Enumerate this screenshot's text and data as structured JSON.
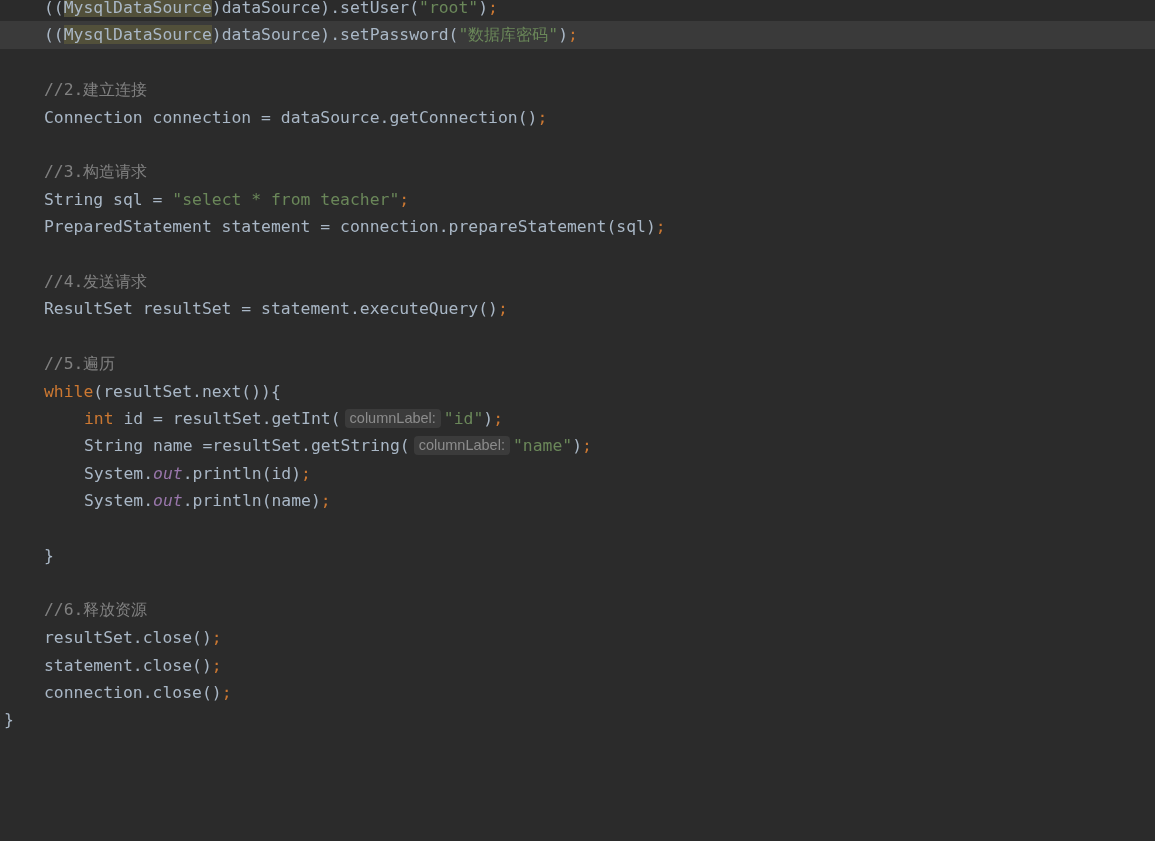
{
  "editor": {
    "items": [
      {
        "kind": "block",
        "children": [
          {
            "kind": "line",
            "current": false,
            "segments": [
              {
                "kind": "code",
                "tokens": [
                  {
                    "kind": "plain",
                    "text": "(("
                  },
                  {
                    "kind": "usage",
                    "text": "MysqlDataSource"
                  },
                  {
                    "kind": "plain",
                    "text": ")dataSource).setUser("
                  },
                  {
                    "kind": "string",
                    "text": "\"root\""
                  },
                  {
                    "kind": "plain",
                    "text": ")"
                  },
                  {
                    "kind": "punct",
                    "text": ";"
                  }
                ]
              }
            ]
          },
          {
            "kind": "line",
            "current": true,
            "segments": [
              {
                "kind": "code",
                "tokens": [
                  {
                    "kind": "plain",
                    "text": "(("
                  },
                  {
                    "kind": "usage",
                    "text": "MysqlDataSource"
                  },
                  {
                    "kind": "plain",
                    "text": ")dataSource).setPassword("
                  },
                  {
                    "kind": "string",
                    "text": "\"数据库密码\""
                  },
                  {
                    "kind": "plain",
                    "text": ")"
                  },
                  {
                    "kind": "punct",
                    "text": ";"
                  }
                ]
              }
            ]
          },
          {
            "kind": "blank"
          },
          {
            "kind": "line",
            "current": false,
            "segments": [
              {
                "kind": "code",
                "tokens": [
                  {
                    "kind": "comment",
                    "text": "//2.建立连接"
                  }
                ]
              }
            ]
          },
          {
            "kind": "line",
            "current": false,
            "segments": [
              {
                "kind": "code",
                "tokens": [
                  {
                    "kind": "plain",
                    "text": "Connection connection = dataSource.getConnection()"
                  },
                  {
                    "kind": "punct",
                    "text": ";"
                  }
                ]
              }
            ]
          },
          {
            "kind": "blank"
          },
          {
            "kind": "line",
            "current": false,
            "segments": [
              {
                "kind": "code",
                "tokens": [
                  {
                    "kind": "comment",
                    "text": "//3.构造请求"
                  }
                ]
              }
            ]
          },
          {
            "kind": "line",
            "current": false,
            "segments": [
              {
                "kind": "code",
                "tokens": [
                  {
                    "kind": "plain",
                    "text": "String sql = "
                  },
                  {
                    "kind": "string",
                    "text": "\"select * from teacher\""
                  },
                  {
                    "kind": "punct",
                    "text": ";"
                  }
                ]
              }
            ]
          },
          {
            "kind": "line",
            "current": false,
            "segments": [
              {
                "kind": "code",
                "tokens": [
                  {
                    "kind": "plain",
                    "text": "PreparedStatement statement = connection.prepareStatement(sql)"
                  },
                  {
                    "kind": "punct",
                    "text": ";"
                  }
                ]
              }
            ]
          },
          {
            "kind": "blank"
          },
          {
            "kind": "line",
            "current": false,
            "segments": [
              {
                "kind": "code",
                "tokens": [
                  {
                    "kind": "comment",
                    "text": "//4.发送请求"
                  }
                ]
              }
            ]
          },
          {
            "kind": "line",
            "current": false,
            "segments": [
              {
                "kind": "code",
                "tokens": [
                  {
                    "kind": "plain",
                    "text": "ResultSet resultSet = statement.executeQuery()"
                  },
                  {
                    "kind": "punct",
                    "text": ";"
                  }
                ]
              }
            ]
          },
          {
            "kind": "blank"
          },
          {
            "kind": "line",
            "current": false,
            "segments": [
              {
                "kind": "code",
                "tokens": [
                  {
                    "kind": "comment",
                    "text": "//5.遍历"
                  }
                ]
              }
            ]
          },
          {
            "kind": "line",
            "current": false,
            "segments": [
              {
                "kind": "code",
                "tokens": [
                  {
                    "kind": "keyword",
                    "text": "while"
                  },
                  {
                    "kind": "plain",
                    "text": "(resultSet.next()){"
                  }
                ]
              }
            ]
          },
          {
            "kind": "block",
            "children": [
              {
                "kind": "line",
                "current": false,
                "segments": [
                  {
                    "kind": "code",
                    "tokens": [
                      {
                        "kind": "keyword",
                        "text": "int"
                      },
                      {
                        "kind": "plain",
                        "text": " id = resultSet.getInt("
                      }
                    ]
                  },
                  {
                    "kind": "hint",
                    "text": "columnLabel:"
                  },
                  {
                    "kind": "code",
                    "tokens": [
                      {
                        "kind": "string",
                        "text": "\"id\""
                      },
                      {
                        "kind": "plain",
                        "text": ")"
                      },
                      {
                        "kind": "punct",
                        "text": ";"
                      }
                    ]
                  }
                ]
              },
              {
                "kind": "line",
                "current": false,
                "segments": [
                  {
                    "kind": "code",
                    "tokens": [
                      {
                        "kind": "plain",
                        "text": "String name =resultSet.getString("
                      }
                    ]
                  },
                  {
                    "kind": "hint",
                    "text": "columnLabel:"
                  },
                  {
                    "kind": "code",
                    "tokens": [
                      {
                        "kind": "string",
                        "text": "\"name\""
                      },
                      {
                        "kind": "plain",
                        "text": ")"
                      },
                      {
                        "kind": "punct",
                        "text": ";"
                      }
                    ]
                  }
                ]
              },
              {
                "kind": "line",
                "current": false,
                "segments": [
                  {
                    "kind": "code",
                    "tokens": [
                      {
                        "kind": "plain",
                        "text": "System."
                      },
                      {
                        "kind": "field",
                        "text": "out"
                      },
                      {
                        "kind": "plain",
                        "text": ".println(id)"
                      },
                      {
                        "kind": "punct",
                        "text": ";"
                      }
                    ]
                  }
                ]
              },
              {
                "kind": "line",
                "current": false,
                "segments": [
                  {
                    "kind": "code",
                    "tokens": [
                      {
                        "kind": "plain",
                        "text": "System."
                      },
                      {
                        "kind": "field",
                        "text": "out"
                      },
                      {
                        "kind": "plain",
                        "text": ".println(name)"
                      },
                      {
                        "kind": "punct",
                        "text": ";"
                      }
                    ]
                  }
                ]
              },
              {
                "kind": "blank"
              }
            ]
          },
          {
            "kind": "line",
            "current": false,
            "segments": [
              {
                "kind": "code",
                "tokens": [
                  {
                    "kind": "plain",
                    "text": "}"
                  }
                ]
              }
            ]
          },
          {
            "kind": "blank"
          },
          {
            "kind": "line",
            "current": false,
            "segments": [
              {
                "kind": "code",
                "tokens": [
                  {
                    "kind": "comment",
                    "text": "//6.释放资源"
                  }
                ]
              }
            ]
          },
          {
            "kind": "line",
            "current": false,
            "segments": [
              {
                "kind": "code",
                "tokens": [
                  {
                    "kind": "plain",
                    "text": "resultSet.close()"
                  },
                  {
                    "kind": "punct",
                    "text": ";"
                  }
                ]
              }
            ]
          },
          {
            "kind": "line",
            "current": false,
            "segments": [
              {
                "kind": "code",
                "tokens": [
                  {
                    "kind": "plain",
                    "text": "statement.close()"
                  },
                  {
                    "kind": "punct",
                    "text": ";"
                  }
                ]
              }
            ]
          },
          {
            "kind": "line",
            "current": false,
            "segments": [
              {
                "kind": "code",
                "tokens": [
                  {
                    "kind": "plain",
                    "text": "connection.close()"
                  },
                  {
                    "kind": "punct",
                    "text": ";"
                  }
                ]
              }
            ]
          }
        ]
      },
      {
        "kind": "line",
        "current": false,
        "segments": [
          {
            "kind": "code",
            "tokens": [
              {
                "kind": "plain",
                "text": "}"
              }
            ]
          }
        ]
      }
    ]
  }
}
